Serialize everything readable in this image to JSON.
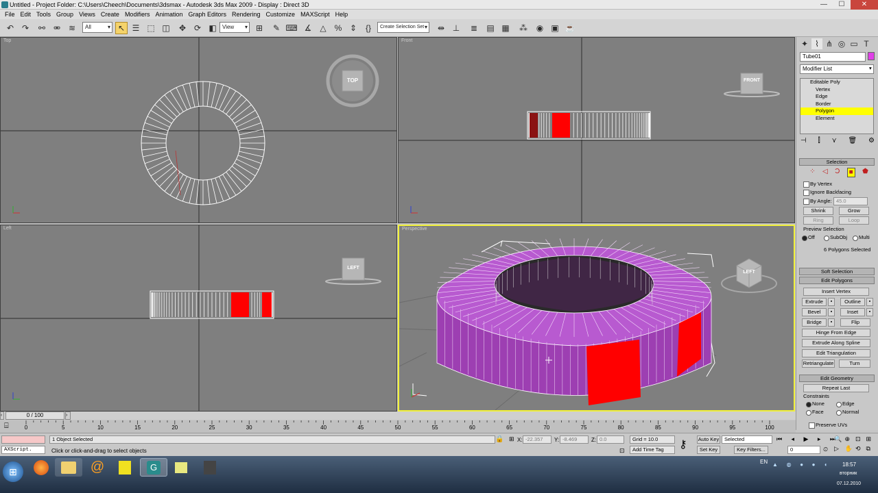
{
  "window": {
    "title": "Untitled    - Project Folder: C:\\Users\\Cheech\\Documents\\3dsmax    - Autodesk 3ds Max  2009      - Display : Direct 3D",
    "min": "—",
    "max": "☐",
    "close": "✕"
  },
  "menu": [
    "File",
    "Edit",
    "Tools",
    "Group",
    "Views",
    "Create",
    "Modifiers",
    "Animation",
    "Graph Editors",
    "Rendering",
    "Customize",
    "MAXScript",
    "Help"
  ],
  "toolbar": {
    "filter_value": "All",
    "refcoord_value": "View",
    "selset_placeholder": "Create Selection Set"
  },
  "viewports": {
    "top": {
      "label": "Top",
      "cube": "TOP"
    },
    "front": {
      "label": "Front",
      "cube": "FRONT"
    },
    "left": {
      "label": "Left",
      "cube": "LEFT"
    },
    "perspective": {
      "label": "Perspective",
      "cube": "LEFT"
    }
  },
  "command_panel": {
    "object_name": "Tube01",
    "object_color": "#e040e8",
    "modifier_list": "Modifier List",
    "stack": {
      "base": "Editable Poly",
      "items": [
        "Vertex",
        "Edge",
        "Border",
        "Polygon",
        "Element"
      ],
      "active_index": 3
    },
    "selection": {
      "header": "Selection",
      "by_vertex": "By Vertex",
      "ignore_backfacing": "Ignore Backfacing",
      "by_angle": "By Angle:",
      "angle_value": "45.0",
      "shrink": "Shrink",
      "grow": "Grow",
      "ring": "Ring",
      "loop": "Loop",
      "preview_title": "Preview Selection",
      "preview_off": "Off",
      "preview_subobj": "SubObj",
      "preview_multi": "Multi",
      "status": "6 Polygons Selected"
    },
    "soft_selection": "Soft Selection",
    "edit_polygons": {
      "header": "Edit Polygons",
      "insert_vertex": "Insert Vertex",
      "extrude": "Extrude",
      "outline": "Outline",
      "bevel": "Bevel",
      "inset": "Inset",
      "bridge": "Bridge",
      "flip": "Flip",
      "hinge": "Hinge From Edge",
      "extrude_spline": "Extrude Along Spline",
      "edit_tri": "Edit Triangulation",
      "retriangulate": "Retriangulate",
      "turn": "Turn"
    },
    "edit_geometry": {
      "header": "Edit Geometry",
      "repeat_last": "Repeat Last",
      "constraints": "Constraints",
      "none": "None",
      "edge": "Edge",
      "face": "Face",
      "normal": "Normal",
      "preserve_uvs": "Preserve UVs"
    }
  },
  "timeline": {
    "frame": "0 / 100",
    "ticks": [
      "0",
      "5",
      "10",
      "15",
      "20",
      "25",
      "30",
      "35",
      "40",
      "45",
      "50",
      "55",
      "60",
      "65",
      "70",
      "75",
      "80",
      "85",
      "90",
      "95",
      "100"
    ]
  },
  "status": {
    "maxscript": "AXScript.",
    "objects": "1 Object Selected",
    "prompt": "Click or click-and-drag to select objects",
    "x_label": "X:",
    "x_value": "-22.357",
    "y_label": "Y:",
    "y_value": "-8.469",
    "z_label": "Z:",
    "z_value": "0.0",
    "grid": "Grid = 10.0",
    "add_time_tag": "Add Time Tag",
    "auto_key": "Auto Key",
    "set_key": "Set Key",
    "selected": "Selected",
    "key_filters": "Key Filters...",
    "frame_value": "0"
  },
  "taskbar": {
    "lang": "EN",
    "time": "18:57",
    "day": "вторник",
    "date": "07.12.2010"
  },
  "colors": {
    "selected_poly": "#ff0000",
    "tube": "#b148c4",
    "tube_top": "#b85ad0",
    "viewport_bg": "#7f7f7f",
    "active_border": "#f1f13a"
  }
}
